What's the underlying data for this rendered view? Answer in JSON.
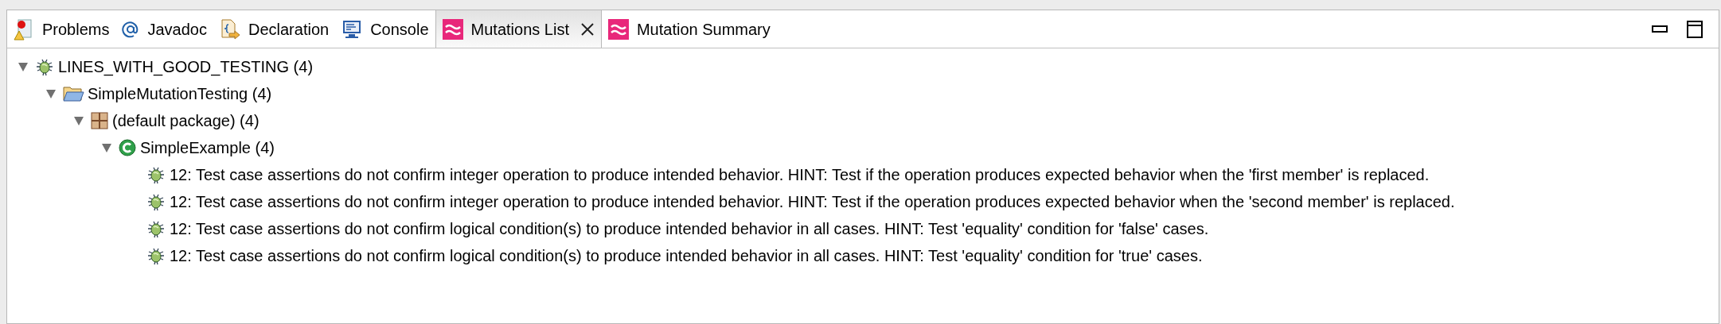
{
  "tabs": [
    {
      "label": "Problems",
      "kind": "problems",
      "selected": false
    },
    {
      "label": "Javadoc",
      "kind": "javadoc",
      "selected": false
    },
    {
      "label": "Declaration",
      "kind": "declaration",
      "selected": false
    },
    {
      "label": "Console",
      "kind": "console",
      "selected": false
    },
    {
      "label": "Mutations List",
      "kind": "mutations",
      "selected": true
    },
    {
      "label": "Mutation Summary",
      "kind": "mutations",
      "selected": false
    }
  ],
  "tree": [
    {
      "label": "LINES_WITH_GOOD_TESTING (4)",
      "kind": "category",
      "expanded": true,
      "children": [
        {
          "label": "SimpleMutationTesting (4)",
          "kind": "project",
          "expanded": true,
          "children": [
            {
              "label": "(default package) (4)",
              "kind": "package",
              "expanded": true,
              "children": [
                {
                  "label": "SimpleExample (4)",
                  "kind": "class",
                  "expanded": true,
                  "children": [
                    {
                      "label": "12: Test case assertions do not confirm integer operation to produce intended behavior. HINT: Test if the operation produces expected behavior when the 'first member' is replaced.",
                      "kind": "mutation"
                    },
                    {
                      "label": "12: Test case assertions do not confirm integer operation to produce intended behavior. HINT: Test if the operation produces expected behavior when the 'second member' is replaced.",
                      "kind": "mutation"
                    },
                    {
                      "label": "12: Test case assertions do not confirm logical condition(s) to produce intended behavior in all cases. HINT: Test 'equality' condition for 'false' cases.",
                      "kind": "mutation"
                    },
                    {
                      "label": "12: Test case assertions do not confirm logical condition(s) to produce intended behavior in all cases. HINT: Test 'equality' condition for 'true' cases.",
                      "kind": "mutation"
                    }
                  ]
                }
              ]
            }
          ]
        }
      ]
    }
  ]
}
